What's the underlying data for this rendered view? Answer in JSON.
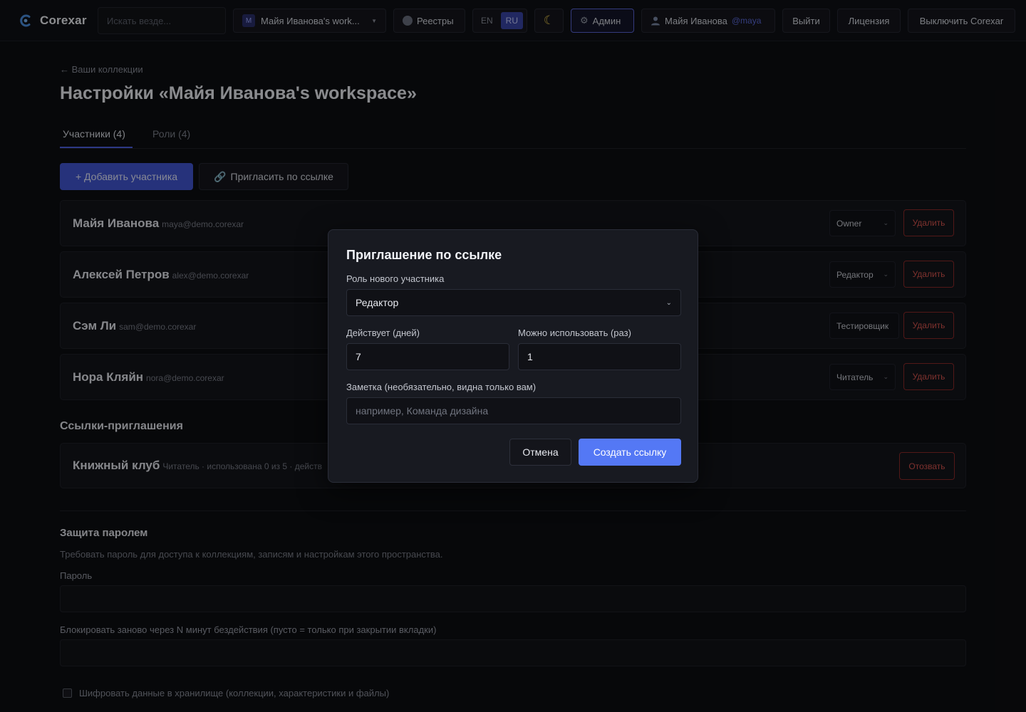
{
  "topbar": {
    "logo_text": "Corexar",
    "search_placeholder": "Искать везде...",
    "workspace_badge": "M",
    "workspace_name": "Майя Иванова's work...",
    "registries_label": "Реестры",
    "lang_en": "EN",
    "lang_ru": "RU",
    "admin_label": "Админ",
    "user_name": "Майя Иванова",
    "user_handle": "@maya",
    "logout_label": "Выйти",
    "license_label": "Лицензия",
    "shutdown_label": "Выключить Corexar"
  },
  "page": {
    "back_link": "← Ваши коллекции",
    "title": "Настройки «Майя Иванова's workspace»",
    "tabs": [
      {
        "label": "Участники (4)",
        "active": true
      },
      {
        "label": "Роли (4)",
        "active": false
      }
    ],
    "add_member_label": "+ Добавить участника",
    "invite_link_label": "Пригласить по ссылке",
    "delete_label": "Удалить",
    "members": [
      {
        "name": "Майя Иванова",
        "email": "maya@demo.corexar",
        "role": "Owner"
      },
      {
        "name": "Алексей Петров",
        "email": "alex@demo.corexar",
        "role": "Редактор"
      },
      {
        "name": "Сэм Ли",
        "email": "sam@demo.corexar",
        "role": "Тестировщик"
      },
      {
        "name": "Нора Кляйн",
        "email": "nora@demo.corexar",
        "role": "Читатель"
      }
    ],
    "invite_links_title": "Ссылки-приглашения",
    "invite_links": [
      {
        "name": "Книжный клуб",
        "meta": "Читатель · использована 0 из 5 · действ",
        "revoke_label": "Отозвать"
      }
    ],
    "password_section": {
      "title": "Защита паролем",
      "description": "Требовать пароль для доступа к коллекциям, записям и настройкам этого пространства.",
      "password_label": "Пароль",
      "password_value": "",
      "relock_label": "Блокировать заново через N минут бездействия (пусто = только при закрытии вкладки)",
      "relock_value": "",
      "encrypt_label": "Шифровать данные в хранилище (коллекции, характеристики и файлы)",
      "encrypt_checked": false
    }
  },
  "modal": {
    "title": "Приглашение по ссылке",
    "role_label": "Роль нового участника",
    "role_value": "Редактор",
    "days_label": "Действует (дней)",
    "days_value": "7",
    "uses_label": "Можно использовать (раз)",
    "uses_value": "1",
    "note_label": "Заметка (необязательно, видна только вам)",
    "note_placeholder": "например, Команда дизайна",
    "cancel_label": "Отмена",
    "create_label": "Создать ссылку"
  },
  "colors": {
    "accent": "#5478f5",
    "primary_button": "#4257d4",
    "danger": "#d9554f",
    "background": "#0d0e12"
  },
  "icons": {
    "logo": "corexar-logo-icon",
    "registries": "globe-icon",
    "theme": "moon-icon",
    "admin": "gear-icon",
    "user": "user-icon",
    "invite": "link-icon",
    "select": "chevron-down-icon"
  }
}
